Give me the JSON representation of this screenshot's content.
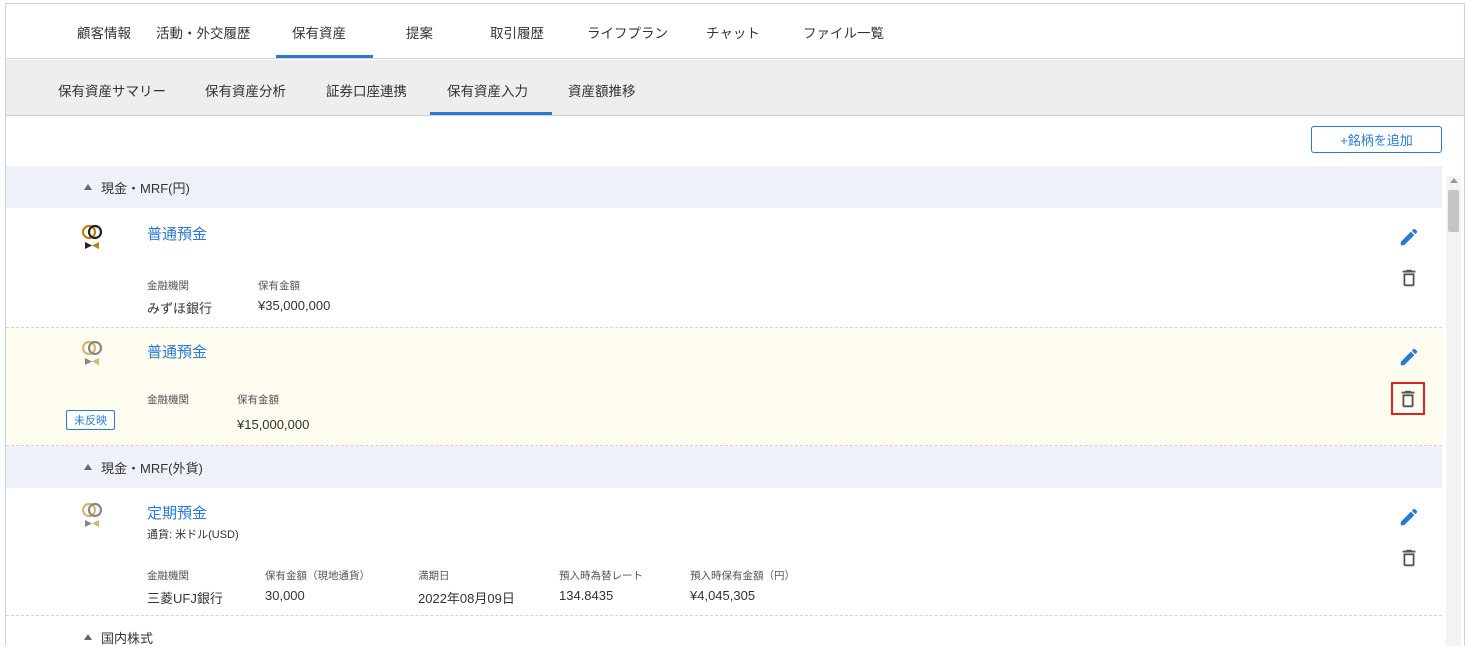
{
  "top_tabs": [
    {
      "label": "顧客情報"
    },
    {
      "label": "活動・外交履歴"
    },
    {
      "label": "保有資産"
    },
    {
      "label": "提案"
    },
    {
      "label": "取引履歴"
    },
    {
      "label": "ライフプラン"
    },
    {
      "label": "チャット"
    },
    {
      "label": "ファイル一覧"
    }
  ],
  "sub_tabs": [
    {
      "label": "保有資産サマリー"
    },
    {
      "label": "保有資産分析"
    },
    {
      "label": "証券口座連携"
    },
    {
      "label": "保有資産入力"
    },
    {
      "label": "資産額推移"
    }
  ],
  "toolbar": {
    "add_label": "+銘柄を追加"
  },
  "sections": [
    {
      "title": "現金・MRF(円)"
    },
    {
      "title": "現金・MRF(外貨)"
    },
    {
      "title": "国内株式"
    }
  ],
  "rows": [
    {
      "title": "普通預金",
      "labels": {
        "institution": "金融機関",
        "amount": "保有金額"
      },
      "values": {
        "institution": "みずほ銀行",
        "amount": "¥35,000,000"
      }
    },
    {
      "title": "普通預金",
      "badge": "未反映",
      "labels": {
        "institution": "金融機関",
        "amount": "保有金額"
      },
      "values": {
        "amount": "¥15,000,000"
      }
    },
    {
      "title": "定期預金",
      "subtitle": "通貨: 米ドル(USD)",
      "labels": {
        "institution": "金融機関",
        "amount": "保有金額（現地通貨）",
        "maturity": "満期日",
        "rate": "預入時為替レート",
        "jpy": "預入時保有金額（円）"
      },
      "values": {
        "institution": "三菱UFJ銀行",
        "amount": "30,000",
        "maturity": "2022年08月09日",
        "rate": "134.8435",
        "jpy": "¥4,045,305"
      }
    }
  ],
  "colors": {
    "accent": "#2a7ad5",
    "pending_row_bg": "#fdfcee",
    "section_bg": "#eef1f7",
    "highlight": "#e02020"
  }
}
